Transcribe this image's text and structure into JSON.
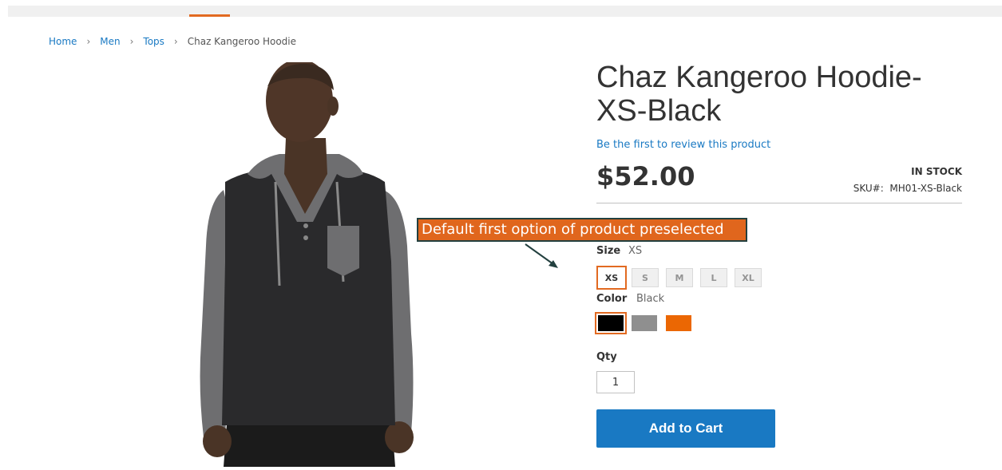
{
  "nav": {
    "active_tab_color": "#e26a21"
  },
  "breadcrumb": {
    "items": [
      "Home",
      "Men",
      "Tops"
    ],
    "current": "Chaz Kangeroo Hoodie",
    "separator": "›"
  },
  "gallery": {
    "image_description_icon": "product-photo-icon"
  },
  "product": {
    "title": "Chaz Kangeroo Hoodie-XS-Black",
    "review_link": "Be the first to review this product",
    "price": "$52.00",
    "stock": "IN STOCK",
    "sku_label": "SKU#:",
    "sku": "MH01-XS-Black"
  },
  "callout": {
    "text": "Default first option of product preselected"
  },
  "options": {
    "size": {
      "label": "Size",
      "selected": "XS",
      "values": [
        "XS",
        "S",
        "M",
        "L",
        "XL"
      ]
    },
    "color": {
      "label": "Color",
      "selected": "Black",
      "swatches": [
        {
          "name": "Black",
          "hex": "#000000"
        },
        {
          "name": "Gray",
          "hex": "#8f8f8f"
        },
        {
          "name": "Orange",
          "hex": "#eb6703"
        }
      ]
    }
  },
  "qty": {
    "label": "Qty",
    "value": "1"
  },
  "cart": {
    "button_label": "Add to Cart"
  },
  "colors": {
    "accent": "#e26a21",
    "link": "#1979c3",
    "button": "#1979c3"
  }
}
